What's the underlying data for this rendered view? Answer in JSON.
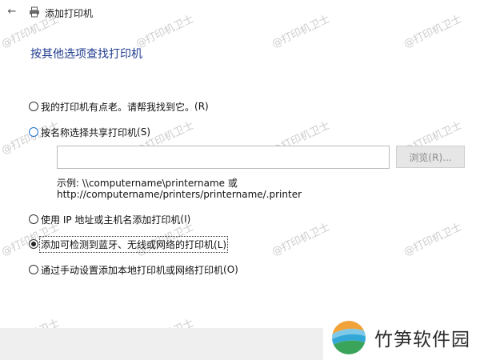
{
  "window": {
    "title": "添加打印机"
  },
  "heading": "按其他选项查找打印机",
  "options": [
    {
      "label": "我的打印机有点老。请帮我找到它。",
      "accel": "(R)",
      "checked": false
    },
    {
      "label": "按名称选择共享打印机",
      "accel": "(S)",
      "checked": false
    },
    {
      "label": "使用 IP 地址或主机名添加打印机",
      "accel": "(I)",
      "checked": false
    },
    {
      "label": "添加可检测到蓝牙、无线或网络的打印机",
      "accel": "(L)",
      "checked": true
    },
    {
      "label": "通过手动设置添加本地打印机或网络打印机",
      "accel": "(O)",
      "checked": false
    }
  ],
  "shared_printer": {
    "input_value": "",
    "browse_label": "浏览(R)...",
    "example_line1": "示例: \\\\computername\\printername 或",
    "example_line2": "http://computername/printers/printername/.printer"
  },
  "watermark": "@打印机卫士",
  "brand": {
    "name": "竹笋软件园"
  },
  "colors": {
    "heading": "#1f3b8f",
    "footer": "#efefef",
    "radio_accent": "#1f6fd1"
  }
}
